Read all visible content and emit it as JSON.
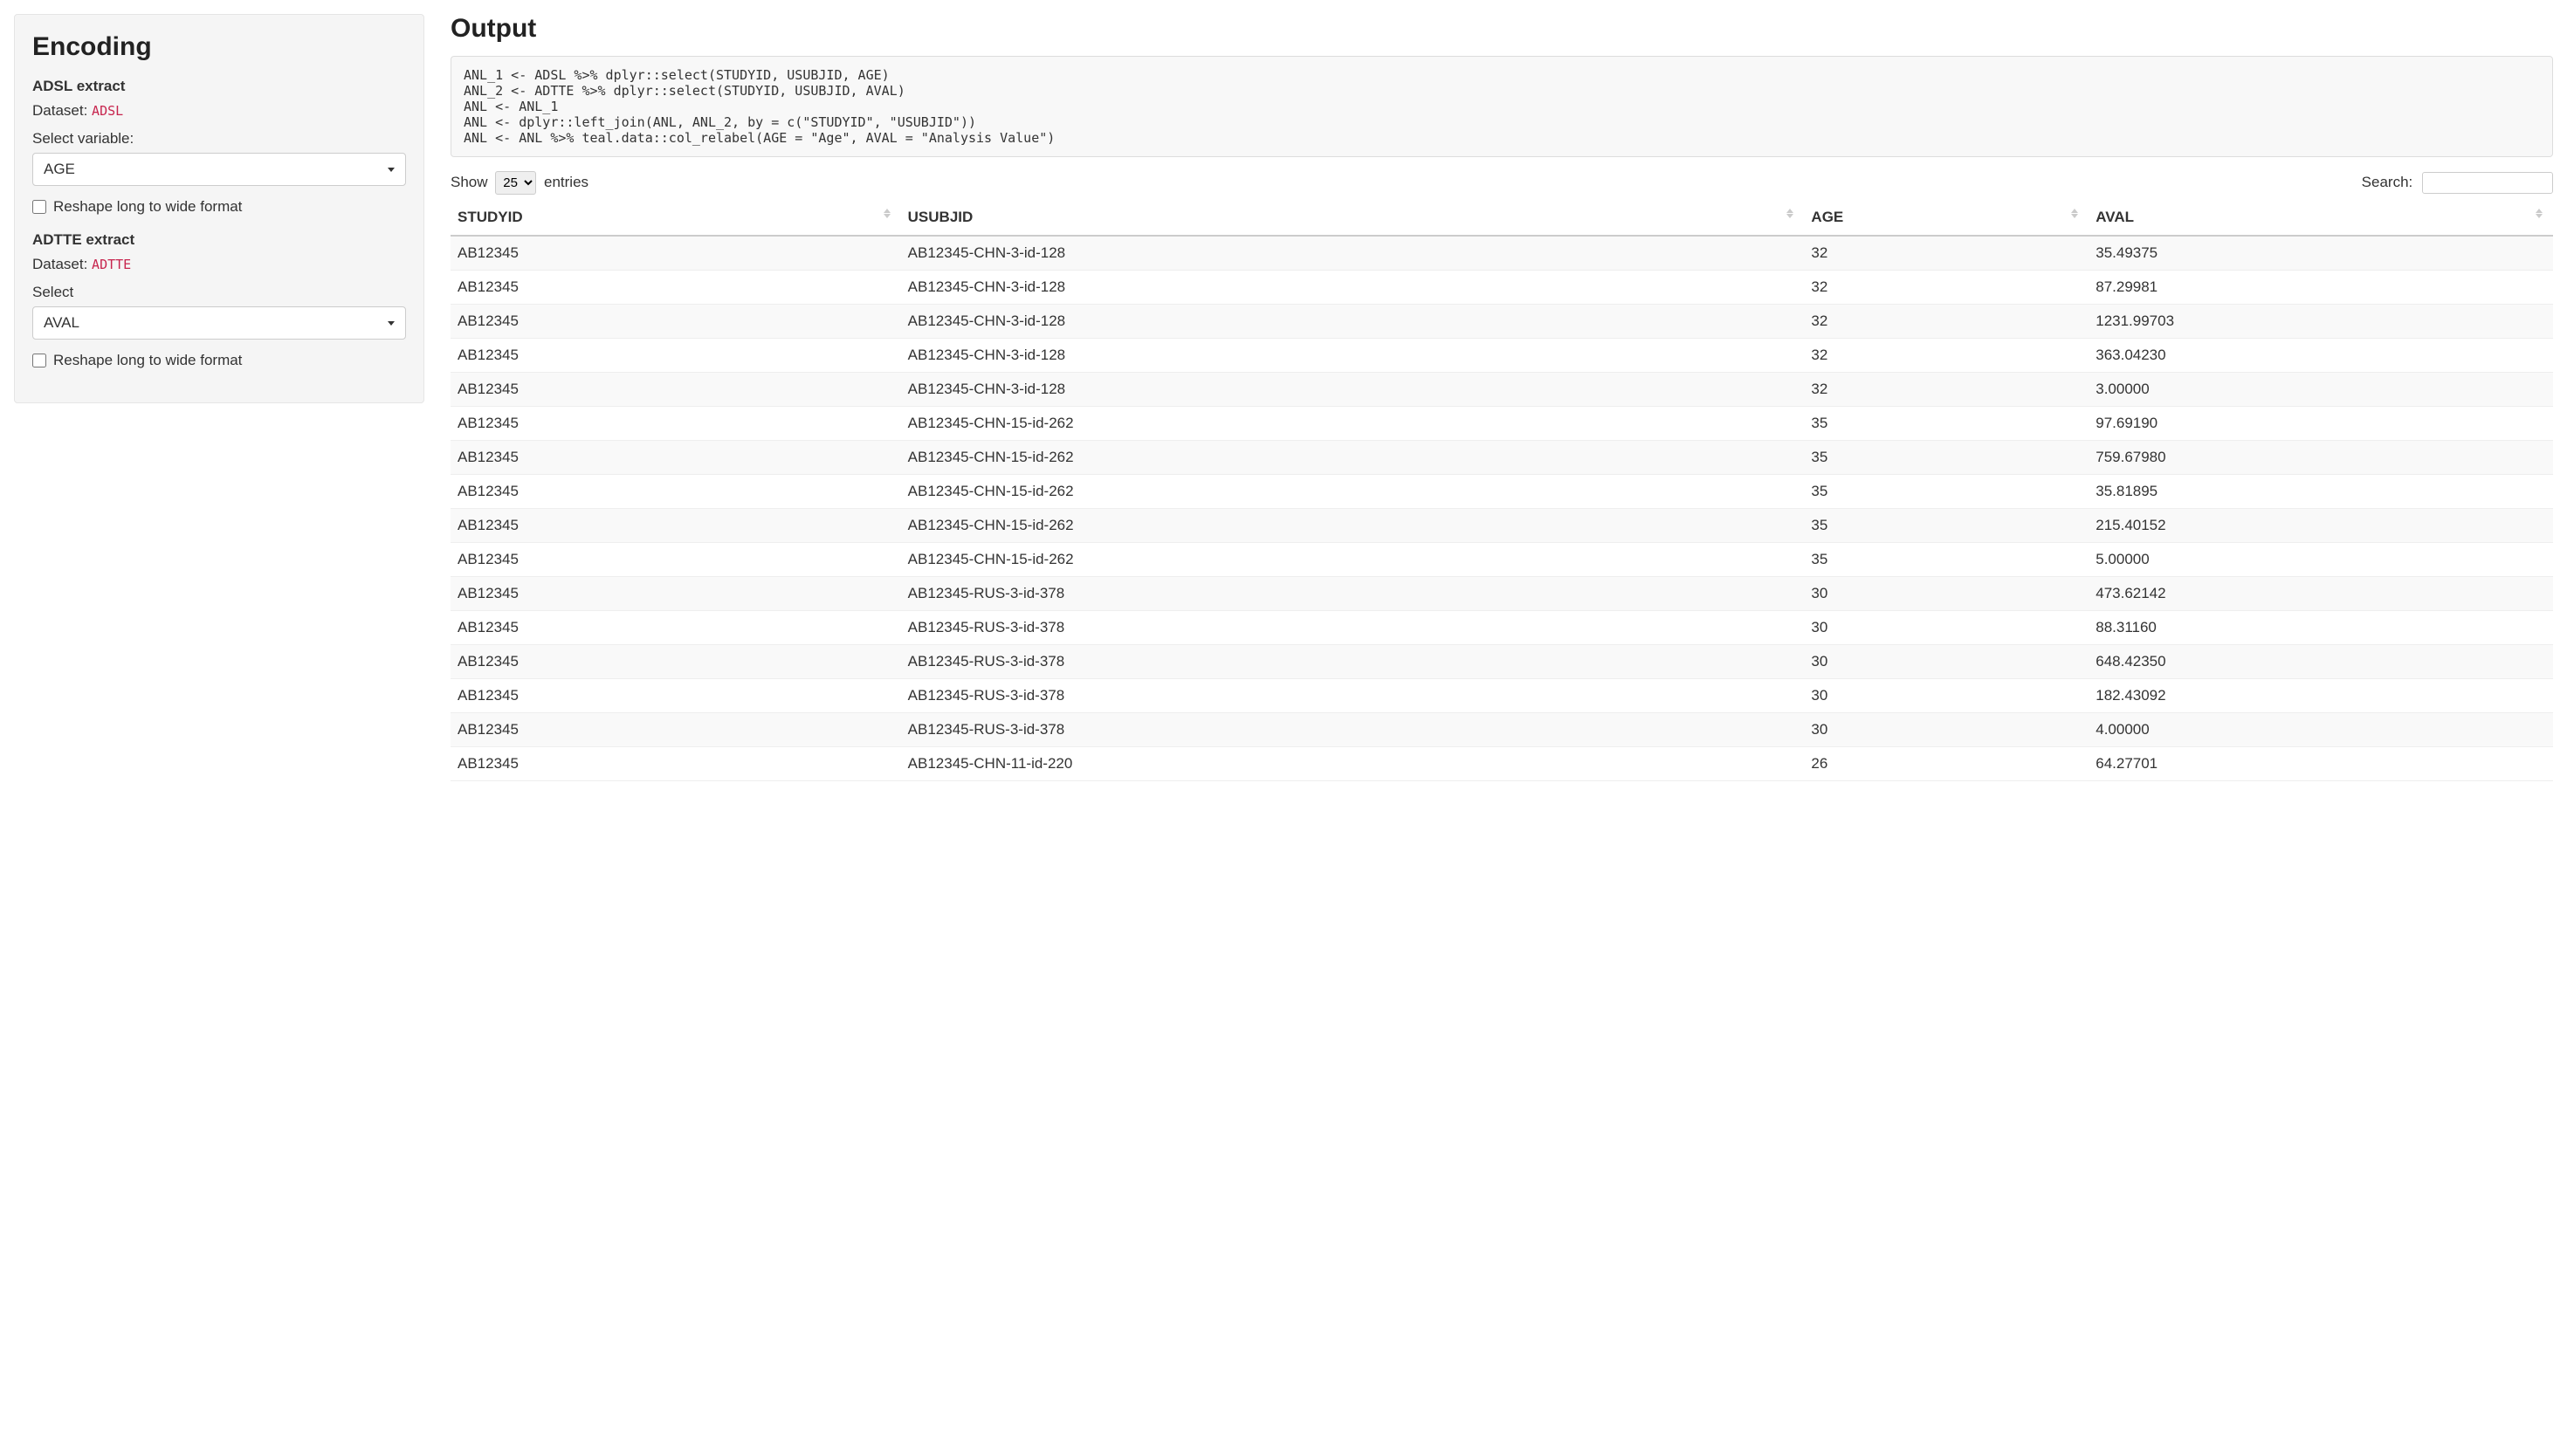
{
  "sidebar": {
    "title": "Encoding",
    "adsl": {
      "heading": "ADSL extract",
      "dataset_label": "Dataset: ",
      "dataset_value": "ADSL",
      "select_label": "Select variable:",
      "select_value": "AGE",
      "reshape_label": "Reshape long to wide format"
    },
    "adtte": {
      "heading": "ADTTE extract",
      "dataset_label": "Dataset: ",
      "dataset_value": "ADTTE",
      "select_label": "Select",
      "select_value": "AVAL",
      "reshape_label": "Reshape long to wide format"
    }
  },
  "output": {
    "title": "Output",
    "code": "ANL_1 <- ADSL %>% dplyr::select(STUDYID, USUBJID, AGE)\nANL_2 <- ADTTE %>% dplyr::select(STUDYID, USUBJID, AVAL)\nANL <- ANL_1\nANL <- dplyr::left_join(ANL, ANL_2, by = c(\"STUDYID\", \"USUBJID\"))\nANL <- ANL %>% teal.data::col_relabel(AGE = \"Age\", AVAL = \"Analysis Value\")",
    "show_label_pre": "Show",
    "show_label_post": "entries",
    "show_value": "25",
    "search_label": "Search:",
    "columns": [
      "STUDYID",
      "USUBJID",
      "AGE",
      "AVAL"
    ],
    "rows": [
      [
        "AB12345",
        "AB12345-CHN-3-id-128",
        "32",
        "35.49375"
      ],
      [
        "AB12345",
        "AB12345-CHN-3-id-128",
        "32",
        "87.29981"
      ],
      [
        "AB12345",
        "AB12345-CHN-3-id-128",
        "32",
        "1231.99703"
      ],
      [
        "AB12345",
        "AB12345-CHN-3-id-128",
        "32",
        "363.04230"
      ],
      [
        "AB12345",
        "AB12345-CHN-3-id-128",
        "32",
        "3.00000"
      ],
      [
        "AB12345",
        "AB12345-CHN-15-id-262",
        "35",
        "97.69190"
      ],
      [
        "AB12345",
        "AB12345-CHN-15-id-262",
        "35",
        "759.67980"
      ],
      [
        "AB12345",
        "AB12345-CHN-15-id-262",
        "35",
        "35.81895"
      ],
      [
        "AB12345",
        "AB12345-CHN-15-id-262",
        "35",
        "215.40152"
      ],
      [
        "AB12345",
        "AB12345-CHN-15-id-262",
        "35",
        "5.00000"
      ],
      [
        "AB12345",
        "AB12345-RUS-3-id-378",
        "30",
        "473.62142"
      ],
      [
        "AB12345",
        "AB12345-RUS-3-id-378",
        "30",
        "88.31160"
      ],
      [
        "AB12345",
        "AB12345-RUS-3-id-378",
        "30",
        "648.42350"
      ],
      [
        "AB12345",
        "AB12345-RUS-3-id-378",
        "30",
        "182.43092"
      ],
      [
        "AB12345",
        "AB12345-RUS-3-id-378",
        "30",
        "4.00000"
      ],
      [
        "AB12345",
        "AB12345-CHN-11-id-220",
        "26",
        "64.27701"
      ]
    ]
  }
}
